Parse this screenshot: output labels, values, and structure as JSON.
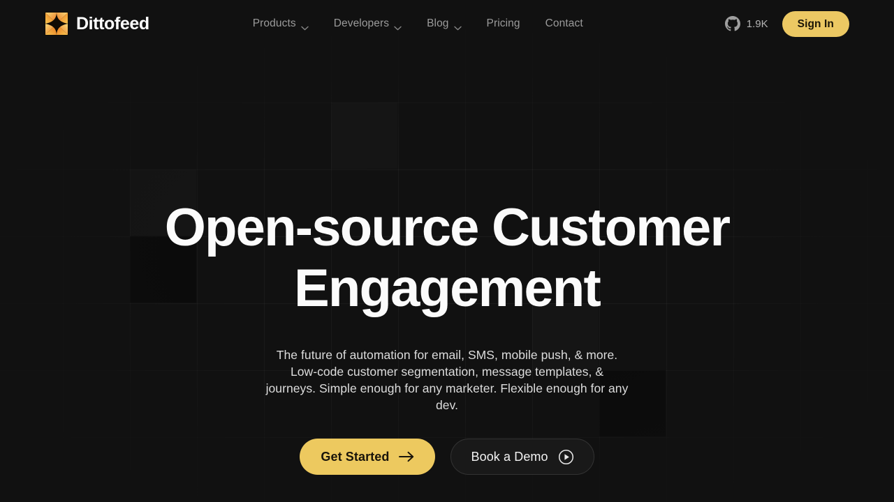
{
  "brand": {
    "name": "Dittofeed",
    "logo_icon": "dittofeed-star-logo",
    "logo_colors": [
      "#f6a02a",
      "#f8c651",
      "#e8711b",
      "#fbd66b"
    ]
  },
  "nav": {
    "items": [
      {
        "label": "Products",
        "has_dropdown": true,
        "icon": "chevron-down-icon"
      },
      {
        "label": "Developers",
        "has_dropdown": true,
        "icon": "chevron-down-icon"
      },
      {
        "label": "Blog",
        "has_dropdown": true,
        "icon": "chevron-down-icon"
      },
      {
        "label": "Pricing",
        "has_dropdown": false,
        "icon": ""
      },
      {
        "label": "Contact",
        "has_dropdown": false,
        "icon": ""
      }
    ]
  },
  "header_right": {
    "github": {
      "icon": "github-icon",
      "count": "1.9K"
    },
    "sign_in_label": "Sign In"
  },
  "hero": {
    "headline": "Open-source Customer Engagement",
    "subhead": "The future of automation for email, SMS, mobile push, & more. Low-code customer segmentation, message templates, & journeys. Simple enough for any marketer. Flexible enough for any dev.",
    "cta_primary": {
      "label": "Get Started",
      "icon": "arrow-right-icon"
    },
    "cta_secondary": {
      "label": "Book a Demo",
      "icon": "play-circle-icon"
    }
  },
  "colors": {
    "background": "#111111",
    "accent": "#edc95f",
    "accent_dark_text": "#19140a",
    "nav_text": "#9b9b9b",
    "headline_text": "#fbfbfb",
    "subhead_text": "#dcdcdc",
    "secondary_button_bg": "#191919",
    "secondary_button_border": "#333333",
    "grid_line": "rgba(255,255,255,0.045)"
  }
}
